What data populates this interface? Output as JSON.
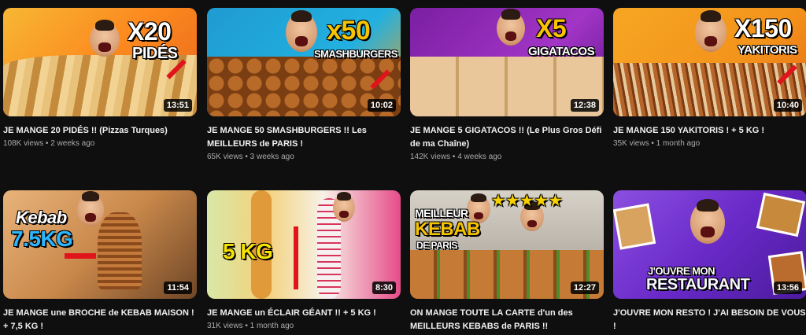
{
  "videos": [
    {
      "title": "JE MANGE 20 PIDÉS !! (Pizzas Turques)",
      "views": "108K views",
      "age": "2 weeks ago",
      "duration": "13:51",
      "overlay": "X20",
      "overlay2": "PIDÉS"
    },
    {
      "title": "JE MANGE 50 SMASHBURGERS !! Les MEILLEURS de PARIS !",
      "views": "65K views",
      "age": "3 weeks ago",
      "duration": "10:02",
      "overlay": "x50",
      "overlay2": "SMASHBURGERS"
    },
    {
      "title": "JE MANGE 5 GIGATACOS !! (Le Plus Gros Défi de ma Chaîne)",
      "views": "142K views",
      "age": "4 weeks ago",
      "duration": "12:38",
      "overlay": "X5",
      "overlay2": "GIGATACOS"
    },
    {
      "title": "JE MANGE 150 YAKITORIS ! + 5 KG !",
      "views": "35K views",
      "age": "1 month ago",
      "duration": "10:40",
      "overlay": "X150",
      "overlay2": "YAKITORIS"
    },
    {
      "title": "JE MANGE une BROCHE de KEBAB MAISON ! + 7,5 KG !",
      "views": "",
      "age": "",
      "duration": "11:54",
      "overlay": "Kebab",
      "overlay2": "7.5KG"
    },
    {
      "title": "JE MANGE un ÉCLAIR GÉANT !! + 5 KG !",
      "views": "31K views",
      "age": "1 month ago",
      "duration": "8:30",
      "overlay": "5 KG",
      "overlay2": ""
    },
    {
      "title": "ON MANGE TOUTE LA CARTE d'un des MEILLEURS KEBABS de PARIS !!",
      "views": "",
      "age": "",
      "duration": "12:27",
      "overlay": "MEILLEUR",
      "overlay2": "KEBAB",
      "overlay3": "DE PARIS",
      "stars": "★★★★★"
    },
    {
      "title": "J'OUVRE MON RESTO ! J'AI BESOIN DE VOUS !",
      "views": "",
      "age": "",
      "duration": "13:56",
      "overlay": "J'OUVRE MON",
      "overlay2": "RESTAURANT"
    }
  ]
}
